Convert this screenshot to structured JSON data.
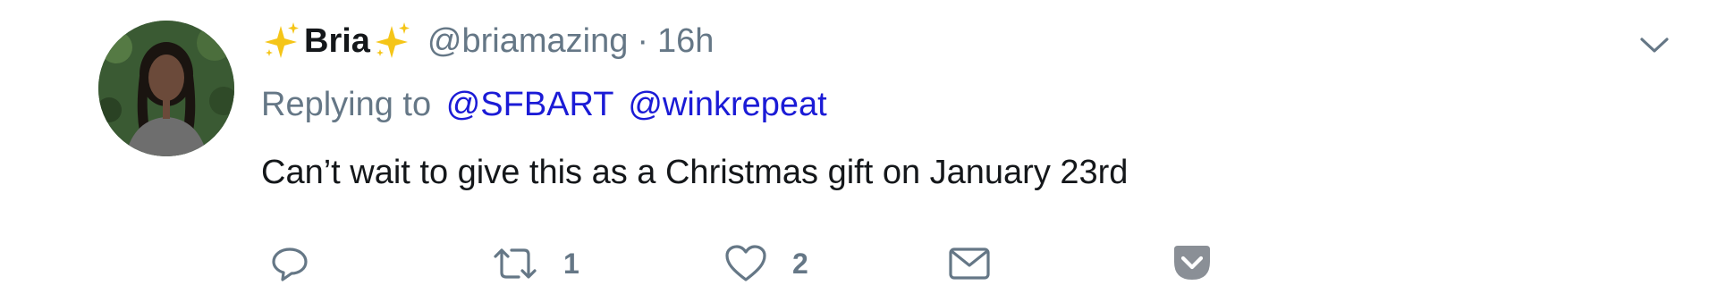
{
  "tweet": {
    "display_name": "Bria",
    "name_emoji": "sparkles-emoji",
    "username": "@briamazing",
    "separator": "·",
    "timestamp": "16h",
    "replying_prefix": "Replying to",
    "replying_to": [
      "@SFBART",
      "@winkrepeat"
    ],
    "text": "Can’t wait to give this as a Christmas gift on January 23rd",
    "actions": {
      "reply": {
        "icon": "reply-icon",
        "count": ""
      },
      "retweet": {
        "icon": "retweet-icon",
        "count": "1"
      },
      "like": {
        "icon": "heart-icon",
        "count": "2"
      },
      "message": {
        "icon": "envelope-icon",
        "count": ""
      },
      "pocket": {
        "icon": "pocket-icon",
        "count": ""
      }
    }
  },
  "colors": {
    "text": "#14171a",
    "muted": "#657786",
    "link": "#1b1bd6",
    "sparkle": "#f5c518",
    "pocket": "#8a8f96"
  }
}
